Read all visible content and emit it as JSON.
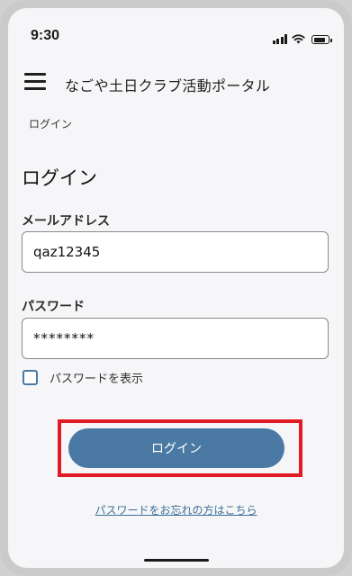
{
  "status_bar": {
    "time": "9:30",
    "battery_level": 0.9
  },
  "header": {
    "title": "なごや土日クラブ活動ポータル"
  },
  "breadcrumb": "ログイン",
  "page_title": "ログイン",
  "form": {
    "email_label": "メールアドレス",
    "email_value": "qaz12345",
    "password_label": "パスワード",
    "password_value": "********",
    "show_password_label": "パスワードを表示",
    "show_password_checked": false,
    "login_button_label": "ログイン",
    "forgot_password_link": "パスワードをお忘れの方はこちら"
  },
  "colors": {
    "accent": "#4a7aa3",
    "highlight": "#e01b24"
  }
}
